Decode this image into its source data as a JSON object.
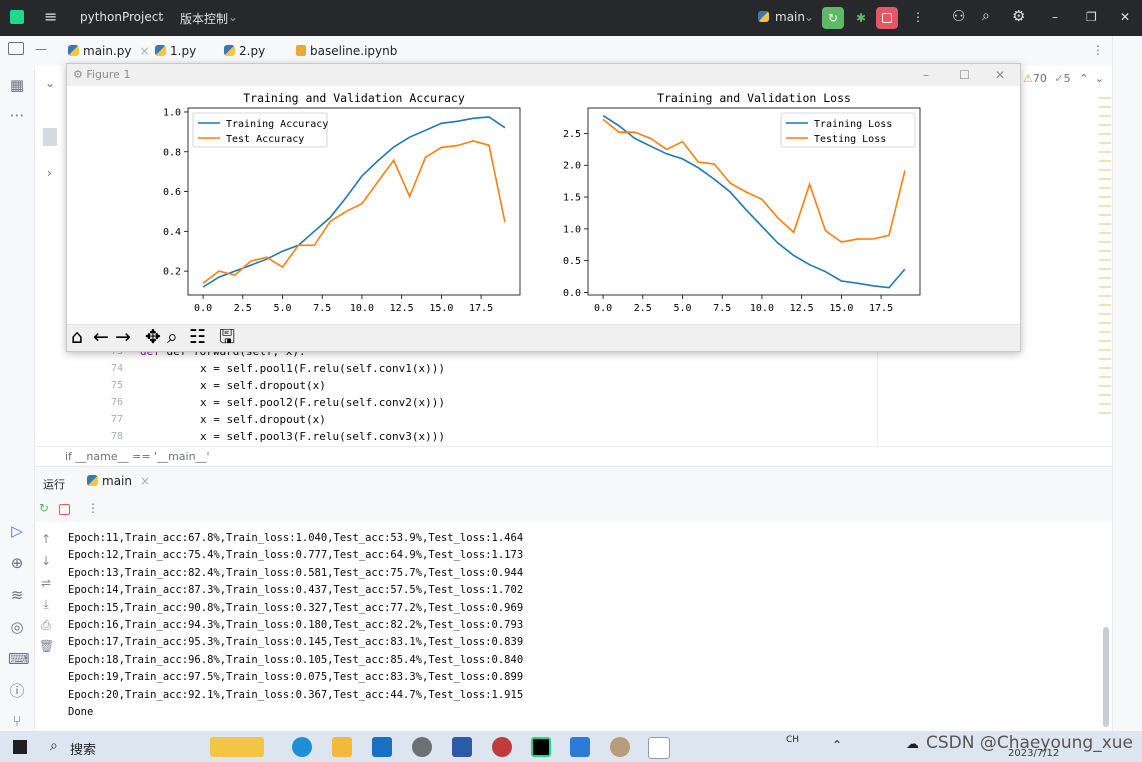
{
  "titlebar": {
    "project": "pythonProject",
    "vcs": "版本控制",
    "branch": "main"
  },
  "tabs": [
    {
      "label": "main.py",
      "active": true
    },
    {
      "label": "1.py",
      "active": false
    },
    {
      "label": "2.py",
      "active": false
    },
    {
      "label": "baseline.ipynb",
      "active": false
    }
  ],
  "inspections": {
    "warnings": "70",
    "ok": "5"
  },
  "editor": {
    "lines": [
      {
        "num": "73",
        "code": "def forward(self, x):"
      },
      {
        "num": "74",
        "code": "x = self.pool1(F.relu(self.conv1(x)))"
      },
      {
        "num": "75",
        "code": "x = self.dropout(x)"
      },
      {
        "num": "76",
        "code": "x = self.pool2(F.relu(self.conv2(x)))"
      },
      {
        "num": "77",
        "code": "x = self.dropout(x)"
      },
      {
        "num": "78",
        "code": "x = self.pool3(F.relu(self.conv3(x)))"
      }
    ],
    "breadcrumb": "if __name__ == '__main__'"
  },
  "run": {
    "label": "运行",
    "tab": "main",
    "lines": [
      "Epoch:11,Train_acc:67.8%,Train_loss:1.040,Test_acc:53.9%,Test_loss:1.464",
      "Epoch:12,Train_acc:75.4%,Train_loss:0.777,Test_acc:64.9%,Test_loss:1.173",
      "Epoch:13,Train_acc:82.4%,Train_loss:0.581,Test_acc:75.7%,Test_loss:0.944",
      "Epoch:14,Train_acc:87.3%,Train_loss:0.437,Test_acc:57.5%,Test_loss:1.702",
      "Epoch:15,Train_acc:90.8%,Train_loss:0.327,Test_acc:77.2%,Test_loss:0.969",
      "Epoch:16,Train_acc:94.3%,Train_loss:0.180,Test_acc:82.2%,Test_loss:0.793",
      "Epoch:17,Train_acc:95.3%,Train_loss:0.145,Test_acc:83.1%,Test_loss:0.839",
      "Epoch:18,Train_acc:96.8%,Train_loss:0.105,Test_acc:85.4%,Test_loss:0.840",
      "Epoch:19,Train_acc:97.5%,Train_loss:0.075,Test_acc:83.3%,Test_loss:0.899",
      "Epoch:20,Train_acc:92.1%,Train_loss:0.367,Test_acc:44.7%,Test_loss:1.915",
      "Done"
    ]
  },
  "figure": {
    "title": "Figure 1"
  },
  "chart_data": [
    {
      "type": "line",
      "title": "Training and Validation Accuracy",
      "x": [
        0,
        1,
        2,
        3,
        4,
        5,
        6,
        7,
        8,
        9,
        10,
        11,
        12,
        13,
        14,
        15,
        16,
        17,
        18,
        19
      ],
      "xticks": [
        "0.0",
        "2.5",
        "5.0",
        "7.5",
        "10.0",
        "12.5",
        "15.0",
        "17.5"
      ],
      "yticks": [
        "0.2",
        "0.4",
        "0.6",
        "0.8",
        "1.0"
      ],
      "xlim": [
        -0.95,
        19.95
      ],
      "ylim": [
        0.08,
        1.02
      ],
      "legend": "upper left",
      "series": [
        {
          "name": "Training Accuracy",
          "color": "#1f77b4",
          "values": [
            0.12,
            0.17,
            0.2,
            0.23,
            0.26,
            0.3,
            0.33,
            0.4,
            0.47,
            0.57,
            0.678,
            0.754,
            0.824,
            0.873,
            0.908,
            0.943,
            0.953,
            0.968,
            0.975,
            0.921
          ]
        },
        {
          "name": "Test Accuracy",
          "color": "#ff7f0e",
          "values": [
            0.14,
            0.2,
            0.18,
            0.25,
            0.27,
            0.22,
            0.33,
            0.33,
            0.45,
            0.5,
            0.539,
            0.649,
            0.757,
            0.575,
            0.772,
            0.822,
            0.831,
            0.854,
            0.833,
            0.447
          ]
        }
      ]
    },
    {
      "type": "line",
      "title": "Training and Validation Loss",
      "x": [
        0,
        1,
        2,
        3,
        4,
        5,
        6,
        7,
        8,
        9,
        10,
        11,
        12,
        13,
        14,
        15,
        16,
        17,
        18,
        19
      ],
      "xticks": [
        "0.0",
        "2.5",
        "5.0",
        "7.5",
        "10.0",
        "12.5",
        "15.0",
        "17.5"
      ],
      "yticks": [
        "0.0",
        "0.5",
        "1.0",
        "1.5",
        "2.0",
        "2.5"
      ],
      "xlim": [
        -0.95,
        19.95
      ],
      "ylim": [
        -0.04,
        2.9
      ],
      "legend": "upper right",
      "series": [
        {
          "name": "Training Loss",
          "color": "#1f77b4",
          "values": [
            2.78,
            2.62,
            2.42,
            2.3,
            2.18,
            2.1,
            1.96,
            1.78,
            1.58,
            1.3,
            1.04,
            0.777,
            0.581,
            0.437,
            0.327,
            0.18,
            0.145,
            0.105,
            0.075,
            0.367
          ]
        },
        {
          "name": "Testing Loss",
          "color": "#ff7f0e",
          "values": [
            2.72,
            2.52,
            2.52,
            2.42,
            2.25,
            2.37,
            2.05,
            2.02,
            1.72,
            1.58,
            1.464,
            1.173,
            0.944,
            1.702,
            0.969,
            0.793,
            0.839,
            0.84,
            0.899,
            1.915
          ]
        }
      ]
    }
  ],
  "taskbar": {
    "search": "搜索",
    "ime": "CH",
    "date": "2023/7/12",
    "watermark": "CSDN @Chaeyoung_xue"
  }
}
